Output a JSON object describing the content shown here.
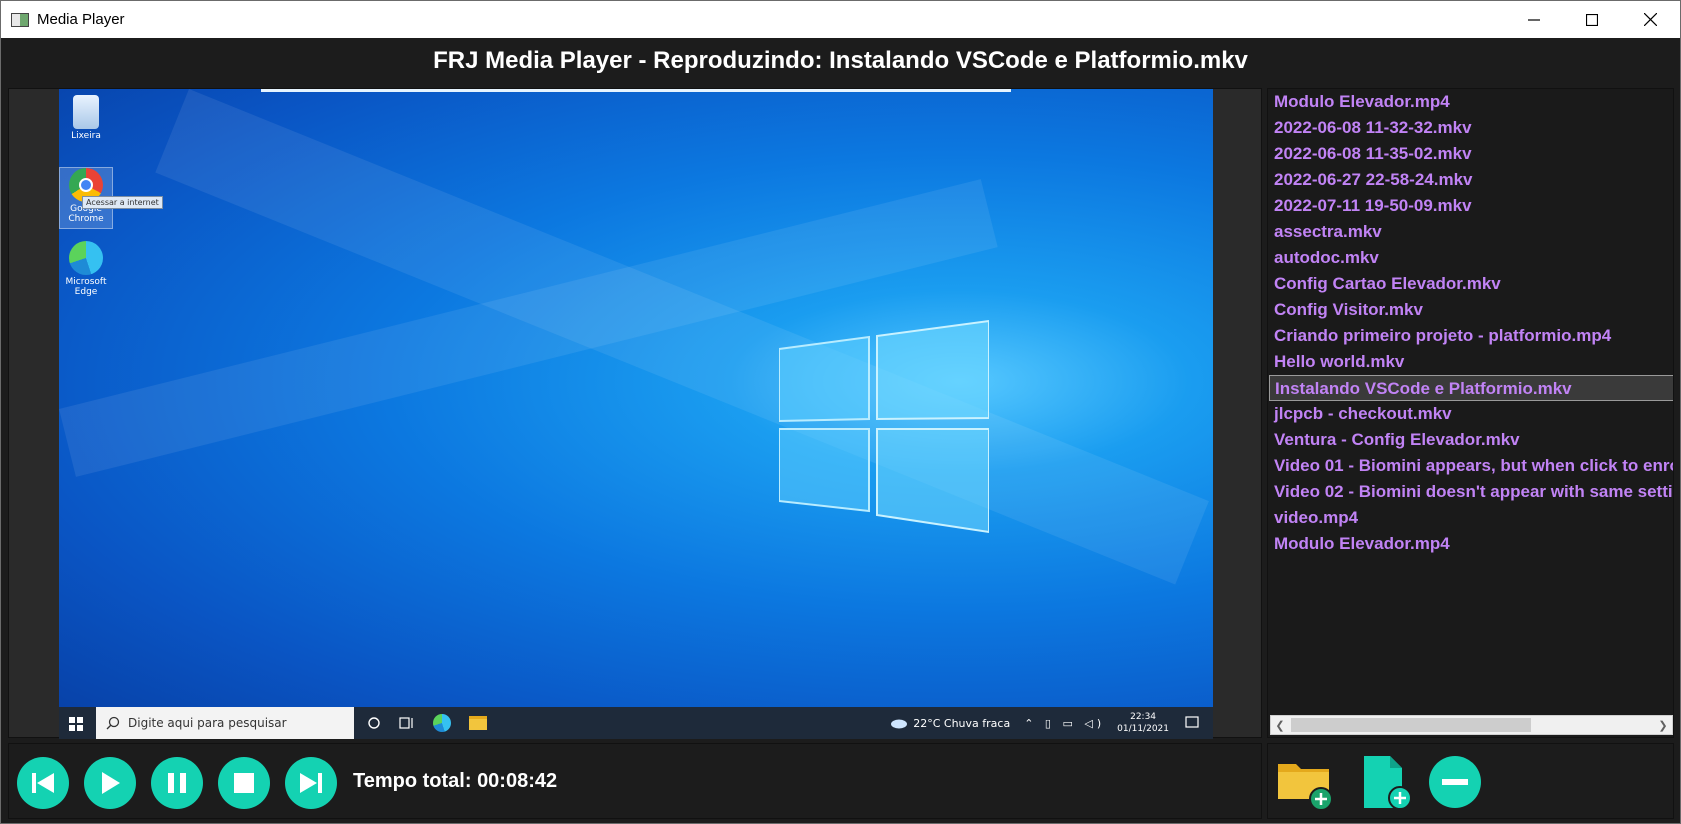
{
  "window": {
    "title": "Media Player",
    "controls": [
      "minimize",
      "maximize",
      "close"
    ]
  },
  "header": {
    "title": "FRJ Media Player - Reproduzindo: Instalando VSCode e Platformio.mkv"
  },
  "video_frame": {
    "desktop_icons": [
      {
        "label": "Lixeira",
        "icon": "recycle-bin-icon"
      },
      {
        "label": "Google Chrome",
        "icon": "chrome-icon"
      },
      {
        "label": "Microsoft Edge",
        "icon": "edge-icon"
      }
    ],
    "tooltip": "Acessar a internet",
    "taskbar": {
      "search_placeholder": "Digite aqui para pesquisar",
      "weather": "22°C  Chuva fraca",
      "time": "22:34",
      "date": "01/11/2021"
    }
  },
  "playlist": {
    "selected_index": 11,
    "items": [
      "Modulo Elevador.mp4",
      "2022-06-08 11-32-32.mkv",
      "2022-06-08 11-35-02.mkv",
      "2022-06-27 22-58-24.mkv",
      "2022-07-11 19-50-09.mkv",
      "assectra.mkv",
      "autodoc.mkv",
      "Config Cartao Elevador.mkv",
      "Config Visitor.mkv",
      "Criando primeiro projeto - platformio.mp4",
      "Hello world.mkv",
      "Instalando VSCode e Platformio.mkv",
      "jlcpcb - checkout.mkv",
      "Ventura - Config Elevador.mkv",
      "Video 01 - Biomini appears, but when click to enro",
      "Video 02 - Biomini doesn't appear with same settin",
      "video.mp4",
      "Modulo Elevador.mp4"
    ]
  },
  "controls": {
    "buttons": [
      {
        "name": "previous-button",
        "icon": "skip-previous-icon"
      },
      {
        "name": "play-button",
        "icon": "play-icon"
      },
      {
        "name": "pause-button",
        "icon": "pause-icon"
      },
      {
        "name": "stop-button",
        "icon": "stop-icon"
      },
      {
        "name": "next-button",
        "icon": "skip-next-icon"
      }
    ],
    "total_time": "Tempo total: 00:08:42"
  },
  "playlist_controls": {
    "buttons": [
      {
        "name": "add-folder-button",
        "icon": "folder-add-icon"
      },
      {
        "name": "add-file-button",
        "icon": "file-add-icon"
      },
      {
        "name": "remove-item-button",
        "icon": "minus-circle-icon"
      }
    ]
  },
  "colors": {
    "accent": "#14d2b2",
    "playlist_text": "#c183f5",
    "background": "#1c1c1c",
    "folder": "#f2c53d"
  }
}
